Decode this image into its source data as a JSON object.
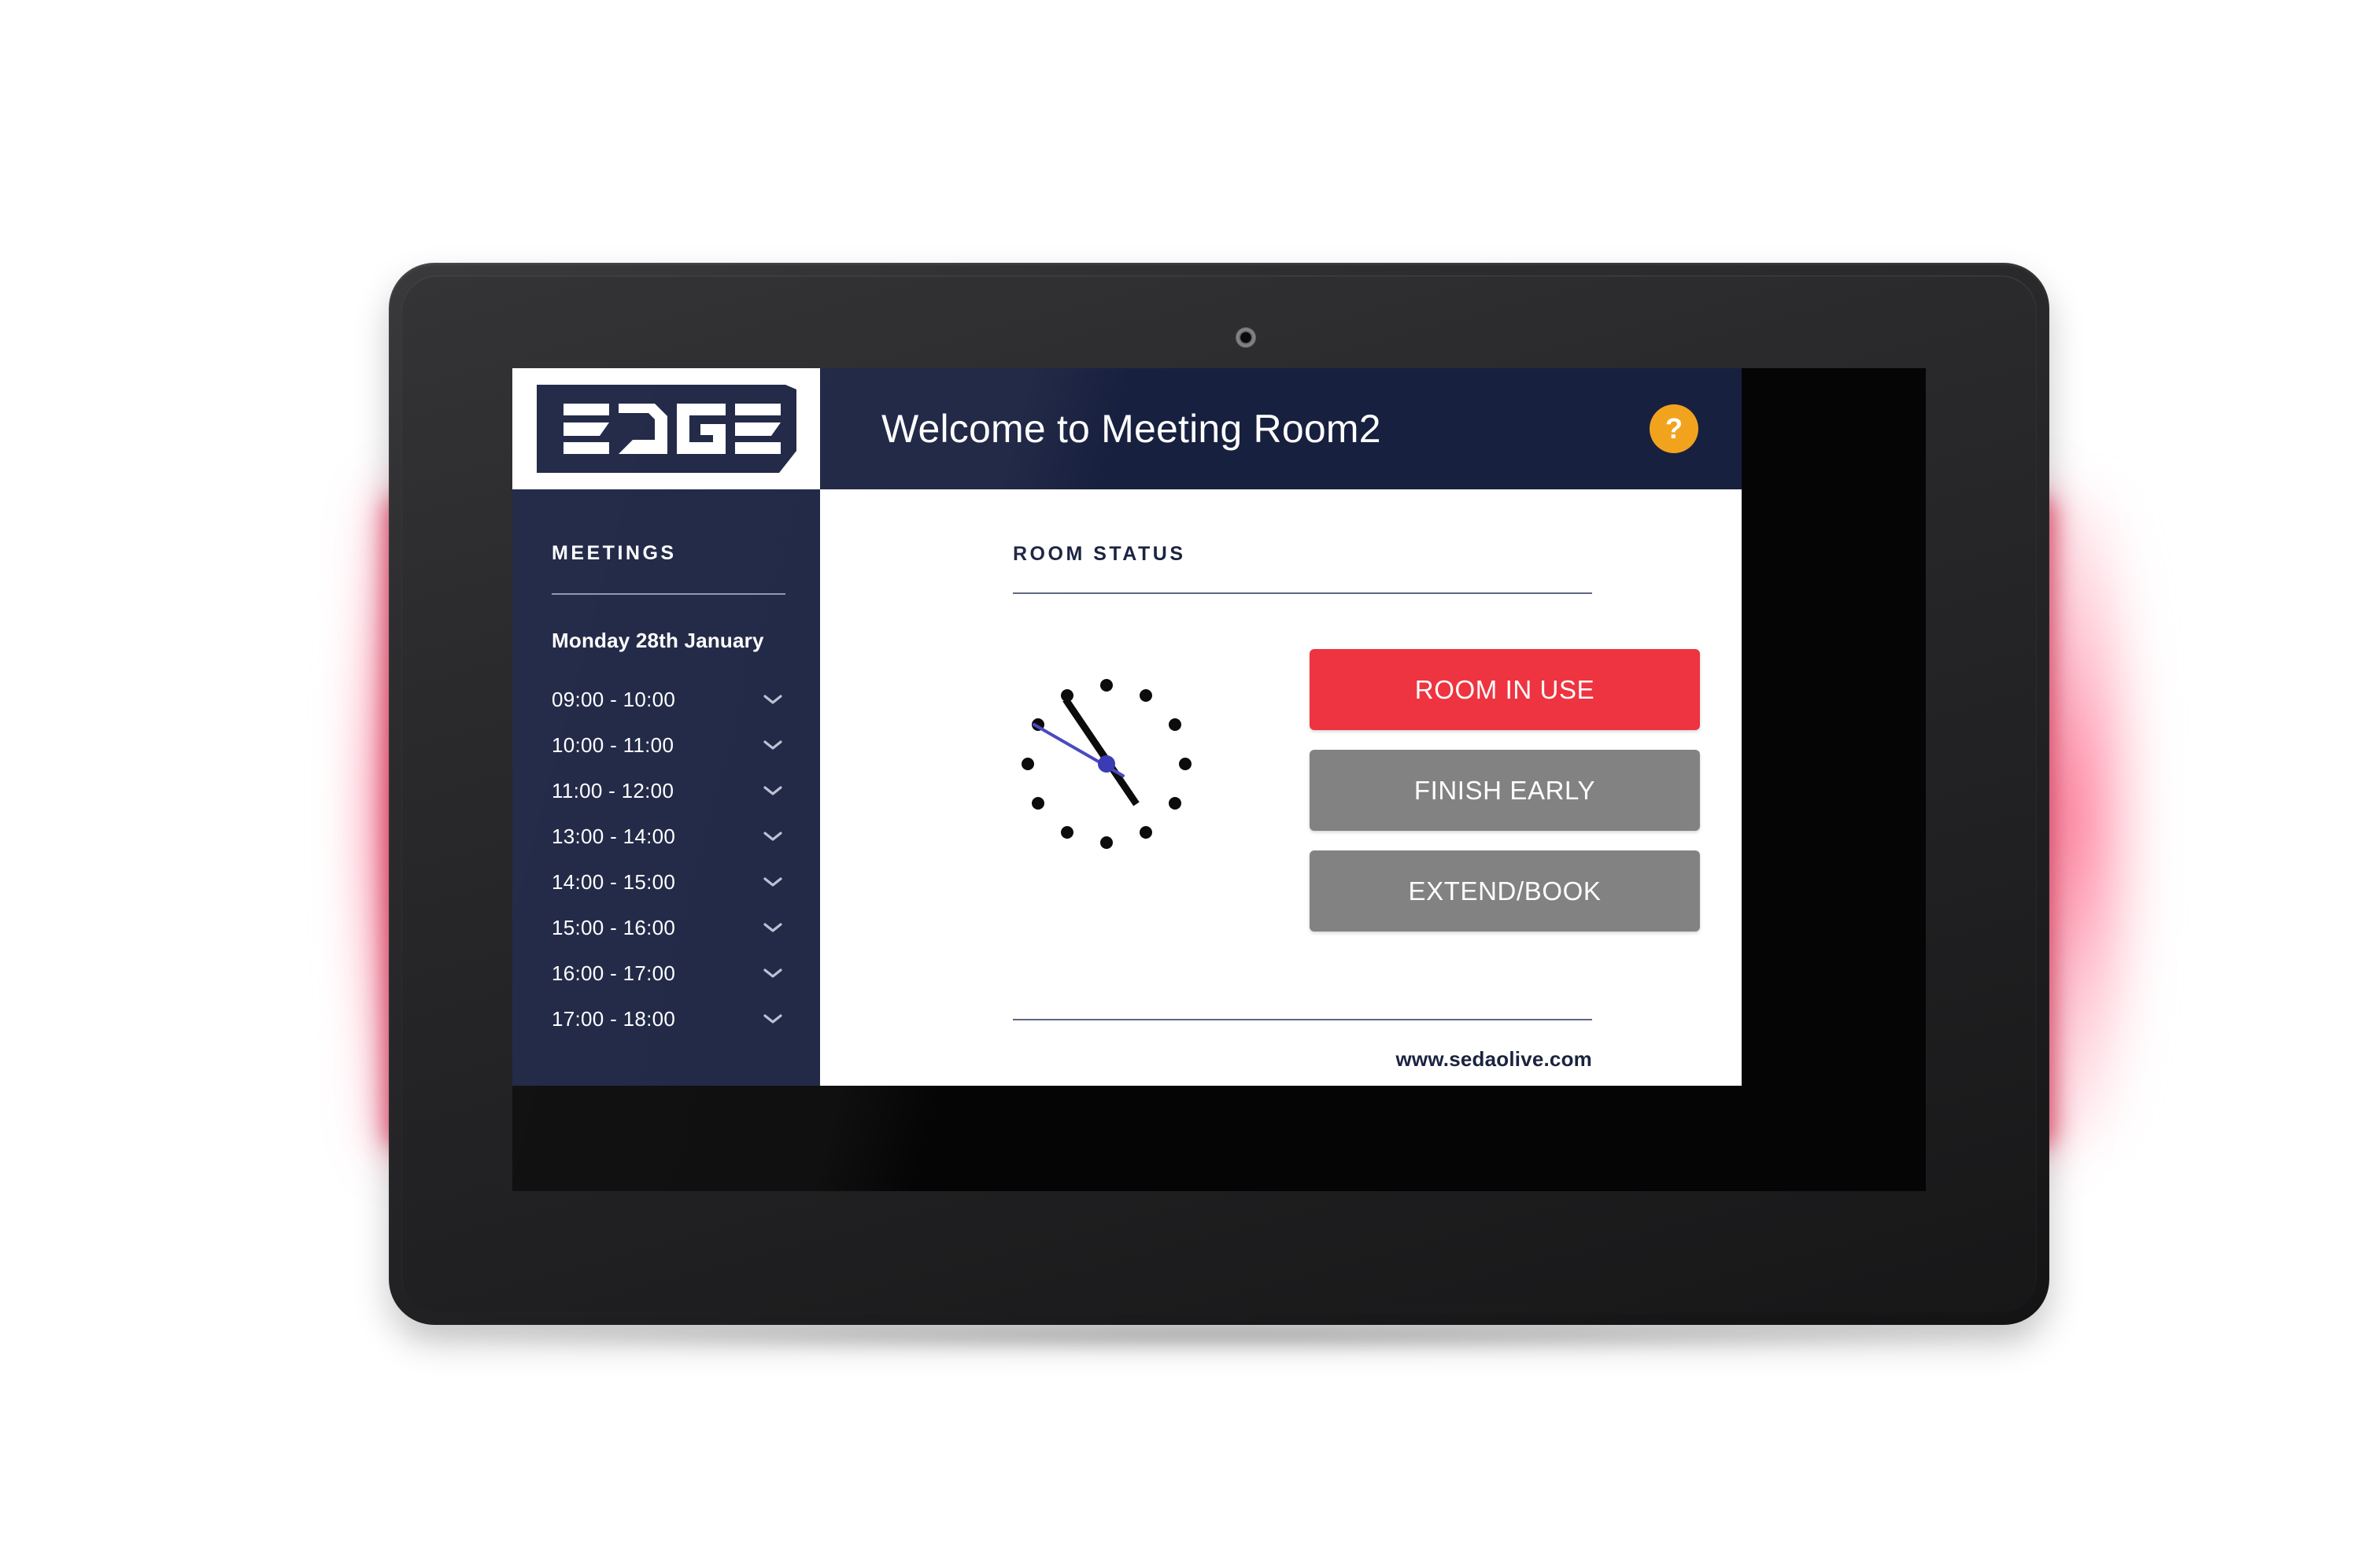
{
  "device": {
    "camera_icon": "camera-lens-icon",
    "led_color": "#f92a46",
    "led_dot_color": "#ff2bbb",
    "led_status": "red"
  },
  "brand": {
    "logo_text": "EDGE",
    "logo_bg": "#18203f"
  },
  "header": {
    "title": "Welcome to Meeting Room2",
    "help_label": "?",
    "help_icon": "question-mark-icon",
    "help_bg": "#f2a31e",
    "bg": "#18203f"
  },
  "sidebar": {
    "heading": "MEETINGS",
    "date": "Monday 28th January",
    "chevron_icon": "chevron-down-icon",
    "slots": [
      {
        "time": "09:00 - 10:00"
      },
      {
        "time": "10:00 - 11:00"
      },
      {
        "time": "11:00 - 12:00"
      },
      {
        "time": "13:00 - 14:00"
      },
      {
        "time": "14:00 - 15:00"
      },
      {
        "time": "15:00 - 16:00"
      },
      {
        "time": "16:00 - 17:00"
      },
      {
        "time": "17:00 - 18:00"
      }
    ]
  },
  "main": {
    "heading": "ROOM STATUS",
    "clock_icon": "analog-clock-icon",
    "buttons": [
      {
        "label": "ROOM IN USE",
        "color": "#ee3440",
        "state": "active"
      },
      {
        "label": "FINISH EARLY",
        "color": "#828282",
        "state": "default"
      },
      {
        "label": "EXTEND/BOOK",
        "color": "#828282",
        "state": "default"
      }
    ],
    "footer_url": "www.sedaolive.com"
  }
}
